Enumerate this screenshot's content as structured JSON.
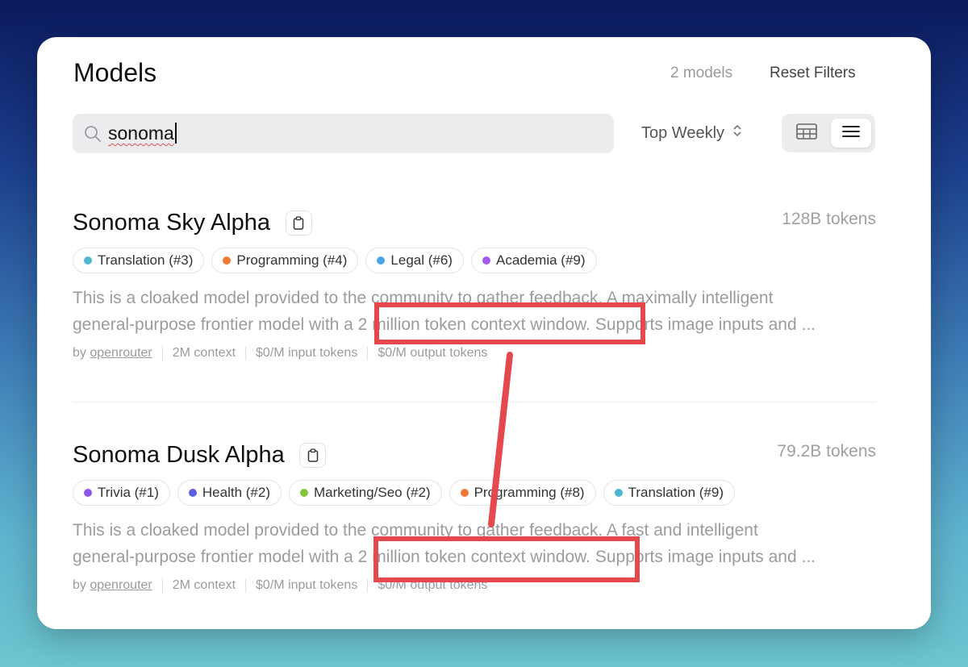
{
  "header": {
    "title": "Models",
    "count": "2 models",
    "reset_label": "Reset Filters"
  },
  "search": {
    "query": "sonoma",
    "placeholder": ""
  },
  "sort": {
    "label": "Top Weekly"
  },
  "view": {
    "options": [
      "table",
      "list"
    ],
    "selected": "list"
  },
  "models": [
    {
      "name": "Sonoma Sky Alpha",
      "tokens": "128B tokens",
      "tags": [
        {
          "label": "Translation (#3)",
          "color": "#4fb6d0"
        },
        {
          "label": "Programming (#4)",
          "color": "#ef7b35"
        },
        {
          "label": "Legal (#6)",
          "color": "#4aa4e8"
        },
        {
          "label": "Academia (#9)",
          "color": "#a25be9"
        }
      ],
      "desc_line1": "This is a cloaked model provided to the community to gather feedback. A maximally intelligent",
      "desc_line2": "general-purpose frontier model with a 2 million token context window. Supports image inputs and ...",
      "author_prefix": "by",
      "author": "openrouter",
      "context": "2M context",
      "input_price": "$0/M input tokens",
      "output_price": "$0/M output tokens"
    },
    {
      "name": "Sonoma Dusk Alpha",
      "tokens": "79.2B tokens",
      "tags": [
        {
          "label": "Trivia (#1)",
          "color": "#8a55e8"
        },
        {
          "label": "Health (#2)",
          "color": "#5b5ee0"
        },
        {
          "label": "Marketing/Seo (#2)",
          "color": "#84c43b"
        },
        {
          "label": "Programming (#8)",
          "color": "#ef7b35"
        },
        {
          "label": "Translation (#9)",
          "color": "#4fb6d0"
        }
      ],
      "desc_line1": "This is a cloaked model provided to the community to gather feedback. A fast and intelligent",
      "desc_line2": "general-purpose frontier model with a 2 million token context window. Supports image inputs and ...",
      "author_prefix": "by",
      "author": "openrouter",
      "context": "2M context",
      "input_price": "$0/M input tokens",
      "output_price": "$0/M output tokens"
    }
  ],
  "annotation_color": "#e5484d"
}
